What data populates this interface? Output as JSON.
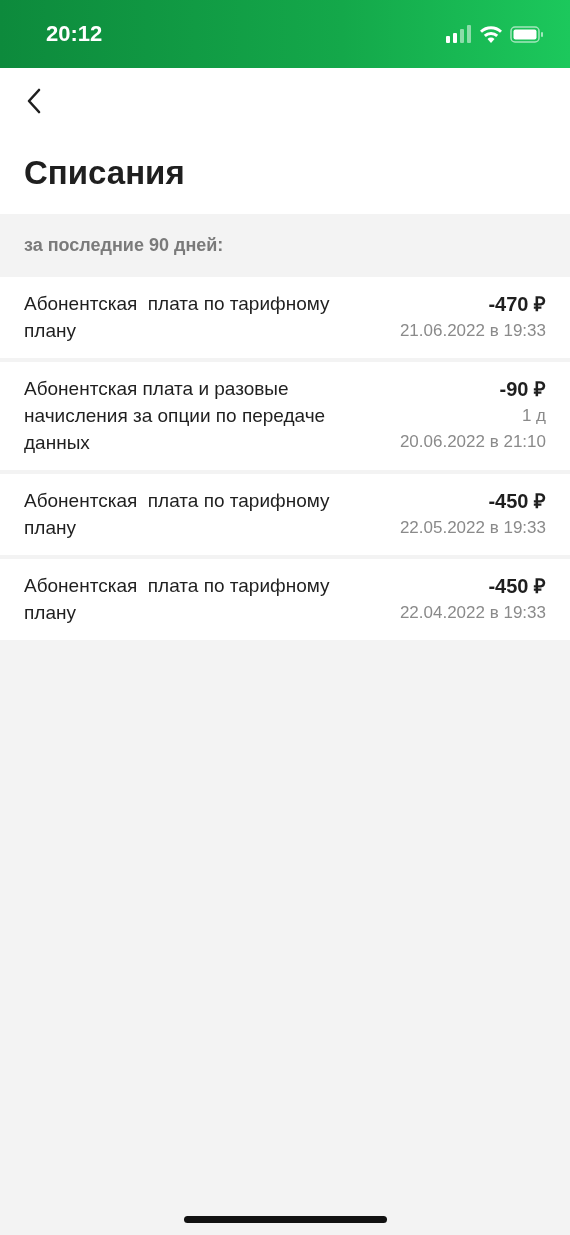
{
  "status_bar": {
    "time": "20:12"
  },
  "title": "Списания",
  "section_header": "за последние 90 дней:",
  "charges": [
    {
      "description": "Абонентская  плата по тарифному плану",
      "amount": "-470 ₽",
      "date": "21.06.2022 в 19:33"
    },
    {
      "description": "Абонентская плата и разовые начисления за опции по передаче данных",
      "amount": "-90 ₽",
      "period": "1 д",
      "date": "20.06.2022 в 21:10"
    },
    {
      "description": "Абонентская  плата по тарифному плану",
      "amount": "-450 ₽",
      "date": "22.05.2022 в 19:33"
    },
    {
      "description": "Абонентская  плата по тарифному плану",
      "amount": "-450 ₽",
      "date": "22.04.2022 в 19:33"
    }
  ]
}
